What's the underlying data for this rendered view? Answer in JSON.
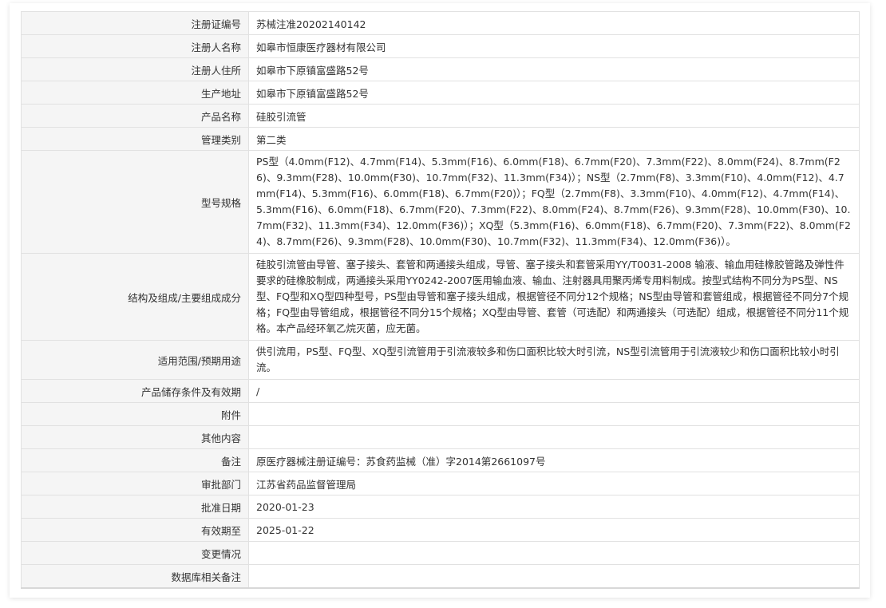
{
  "rows": [
    {
      "label": "注册证编号",
      "value": "苏械注准20202140142"
    },
    {
      "label": "注册人名称",
      "value": "如皋市恒康医疗器材有限公司"
    },
    {
      "label": "注册人住所",
      "value": "如皋市下原镇富盛路52号"
    },
    {
      "label": "生产地址",
      "value": "如皋市下原镇富盛路52号"
    },
    {
      "label": "产品名称",
      "value": "硅胶引流管"
    },
    {
      "label": "管理类别",
      "value": "第二类"
    },
    {
      "label": "型号规格",
      "value": "PS型（4.0mm(F12)、4.7mm(F14)、5.3mm(F16)、6.0mm(F18)、6.7mm(F20)、7.3mm(F22)、8.0mm(F24)、8.7mm(F26)、9.3mm(F28)、10.0mm(F30)、10.7mm(F32)、11.3mm(F34)）；NS型（2.7mm(F8)、3.3mm(F10)、4.0mm(F12)、4.7mm(F14)、5.3mm(F16)、6.0mm(F18)、6.7mm(F20)）；FQ型（2.7mm(F8)、3.3mm(F10)、4.0mm(F12)、4.7mm(F14)、5.3mm(F16)、6.0mm(F18)、6.7mm(F20)、7.3mm(F22)、8.0mm(F24)、8.7mm(F26)、9.3mm(F28)、10.0mm(F30)、10.7mm(F32)、11.3mm(F34)、12.0mm(F36)）；XQ型（5.3mm(F16)、6.0mm(F18)、6.7mm(F20)、7.3mm(F22)、8.0mm(F24)、8.7mm(F26)、9.3mm(F28)、10.0mm(F30)、10.7mm(F32)、11.3mm(F34)、12.0mm(F36)）。"
    },
    {
      "label": "结构及组成/主要组成成分",
      "value": "硅胶引流管由导管、塞子接头、套管和两通接头组成，导管、塞子接头和套管采用YY/T0031-2008 输液、输血用硅橡胶管路及弹性件要求的硅橡胶制成，两通接头采用YY0242-2007医用输血液、输血、注射器具用聚丙烯专用料制成。按型式结构不同分为PS型、NS型、FQ型和XQ型四种型号，PS型由导管和塞子接头组成，根据管径不同分12个规格；NS型由导管和套管组成，根据管径不同分7个规格；FQ型由导管组成，根据管径不同分15个规格；XQ型由导管、套管（可选配）和两通接头（可选配）组成，根据管径不同分11个规格。本产品经环氧乙烷灭菌，应无菌。"
    },
    {
      "label": "适用范围/预期用途",
      "value": "供引流用，PS型、FQ型、XQ型引流管用于引流液较多和伤口面积比较大时引流，NS型引流管用于引流液较少和伤口面积比较小时引流。"
    },
    {
      "label": "产品储存条件及有效期",
      "value": "/"
    },
    {
      "label": "附件",
      "value": ""
    },
    {
      "label": "其他内容",
      "value": ""
    },
    {
      "label": "备注",
      "value": "原医疗器械注册证编号：苏食药监械（准）字2014第2661097号"
    },
    {
      "label": "审批部门",
      "value": "江苏省药品监督管理局"
    },
    {
      "label": "批准日期",
      "value": "2020-01-23"
    },
    {
      "label": "有效期至",
      "value": "2025-01-22"
    },
    {
      "label": "变更情况",
      "value": ""
    },
    {
      "label": "数据库相关备注",
      "value": ""
    }
  ]
}
